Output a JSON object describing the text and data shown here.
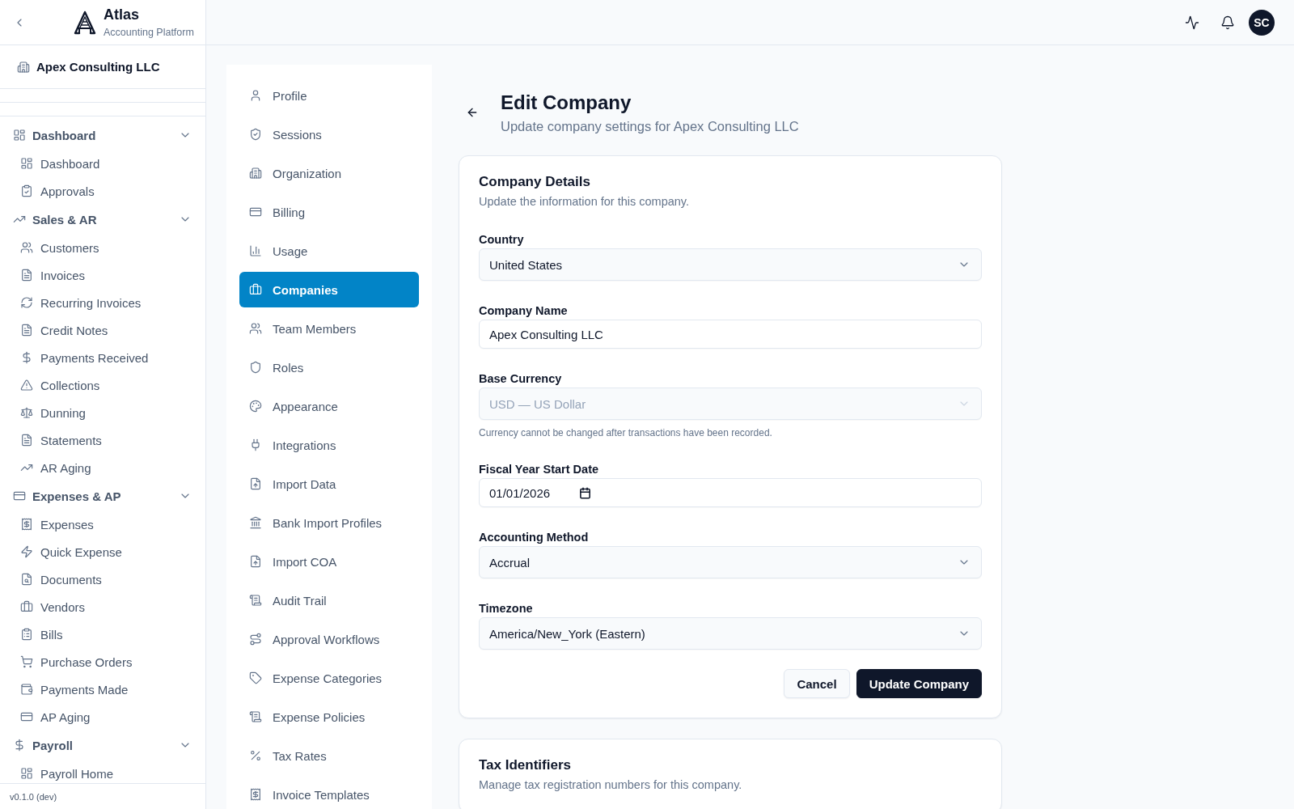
{
  "sidebar": {
    "brand": {
      "name": "Atlas",
      "tagline": "Accounting Platform"
    },
    "organization": "Apex Consulting LLC",
    "nav_groups": [
      {
        "label": "Dashboard",
        "expanded": true,
        "items": [
          {
            "label": "Dashboard"
          },
          {
            "label": "Approvals"
          }
        ]
      },
      {
        "label": "Sales & AR",
        "expanded": true,
        "items": [
          {
            "label": "Customers"
          },
          {
            "label": "Invoices"
          },
          {
            "label": "Recurring Invoices"
          },
          {
            "label": "Credit Notes"
          },
          {
            "label": "Payments Received"
          },
          {
            "label": "Collections"
          },
          {
            "label": "Dunning"
          },
          {
            "label": "Statements"
          },
          {
            "label": "AR Aging"
          }
        ]
      },
      {
        "label": "Expenses & AP",
        "expanded": true,
        "items": [
          {
            "label": "Expenses"
          },
          {
            "label": "Quick Expense"
          },
          {
            "label": "Documents"
          },
          {
            "label": "Vendors"
          },
          {
            "label": "Bills"
          },
          {
            "label": "Purchase Orders"
          },
          {
            "label": "Payments Made"
          },
          {
            "label": "AP Aging"
          }
        ]
      },
      {
        "label": "Payroll",
        "expanded": true,
        "items": [
          {
            "label": "Payroll Home"
          }
        ]
      }
    ],
    "version": "v0.1.0 (dev)"
  },
  "top_bar": {
    "avatar_initials": "SC"
  },
  "settings_nav": {
    "items": [
      {
        "label": "Profile",
        "selected": false
      },
      {
        "label": "Sessions",
        "selected": false
      },
      {
        "label": "Organization",
        "selected": false
      },
      {
        "label": "Billing",
        "selected": false
      },
      {
        "label": "Usage",
        "selected": false
      },
      {
        "label": "Companies",
        "selected": true
      },
      {
        "label": "Team Members",
        "selected": false
      },
      {
        "label": "Roles",
        "selected": false
      },
      {
        "label": "Appearance",
        "selected": false
      },
      {
        "label": "Integrations",
        "selected": false
      },
      {
        "label": "Import Data",
        "selected": false
      },
      {
        "label": "Bank Import Profiles",
        "selected": false
      },
      {
        "label": "Import COA",
        "selected": false
      },
      {
        "label": "Audit Trail",
        "selected": false
      },
      {
        "label": "Approval Workflows",
        "selected": false
      },
      {
        "label": "Expense Categories",
        "selected": false
      },
      {
        "label": "Expense Policies",
        "selected": false
      },
      {
        "label": "Tax Rates",
        "selected": false
      },
      {
        "label": "Invoice Templates",
        "selected": false
      }
    ]
  },
  "page": {
    "title": "Edit Company",
    "subtitle": "Update company settings for Apex Consulting LLC"
  },
  "company_details": {
    "title": "Company Details",
    "description": "Update the information for this company.",
    "fields": [
      {
        "kind": "select",
        "label": "Country",
        "value": "United States",
        "disabled": false
      },
      {
        "kind": "text",
        "label": "Company Name",
        "value": "Apex Consulting LLC",
        "disabled": false
      },
      {
        "kind": "select",
        "label": "Base Currency",
        "value": "USD — US Dollar",
        "disabled": true,
        "hint": "Currency cannot be changed after transactions have been recorded."
      },
      {
        "kind": "date",
        "label": "Fiscal Year Start Date",
        "value": "01/01/2026",
        "disabled": false
      },
      {
        "kind": "select",
        "label": "Accounting Method",
        "value": "Accrual",
        "disabled": false
      },
      {
        "kind": "select",
        "label": "Timezone",
        "value": "America/New_York (Eastern)",
        "disabled": false
      }
    ],
    "buttons": [
      {
        "kind": "secondary",
        "label": "Cancel"
      },
      {
        "kind": "primary",
        "label": "Update Company"
      }
    ]
  },
  "tax_identifiers": {
    "title": "Tax Identifiers",
    "description": "Manage tax registration numbers for this company."
  }
}
